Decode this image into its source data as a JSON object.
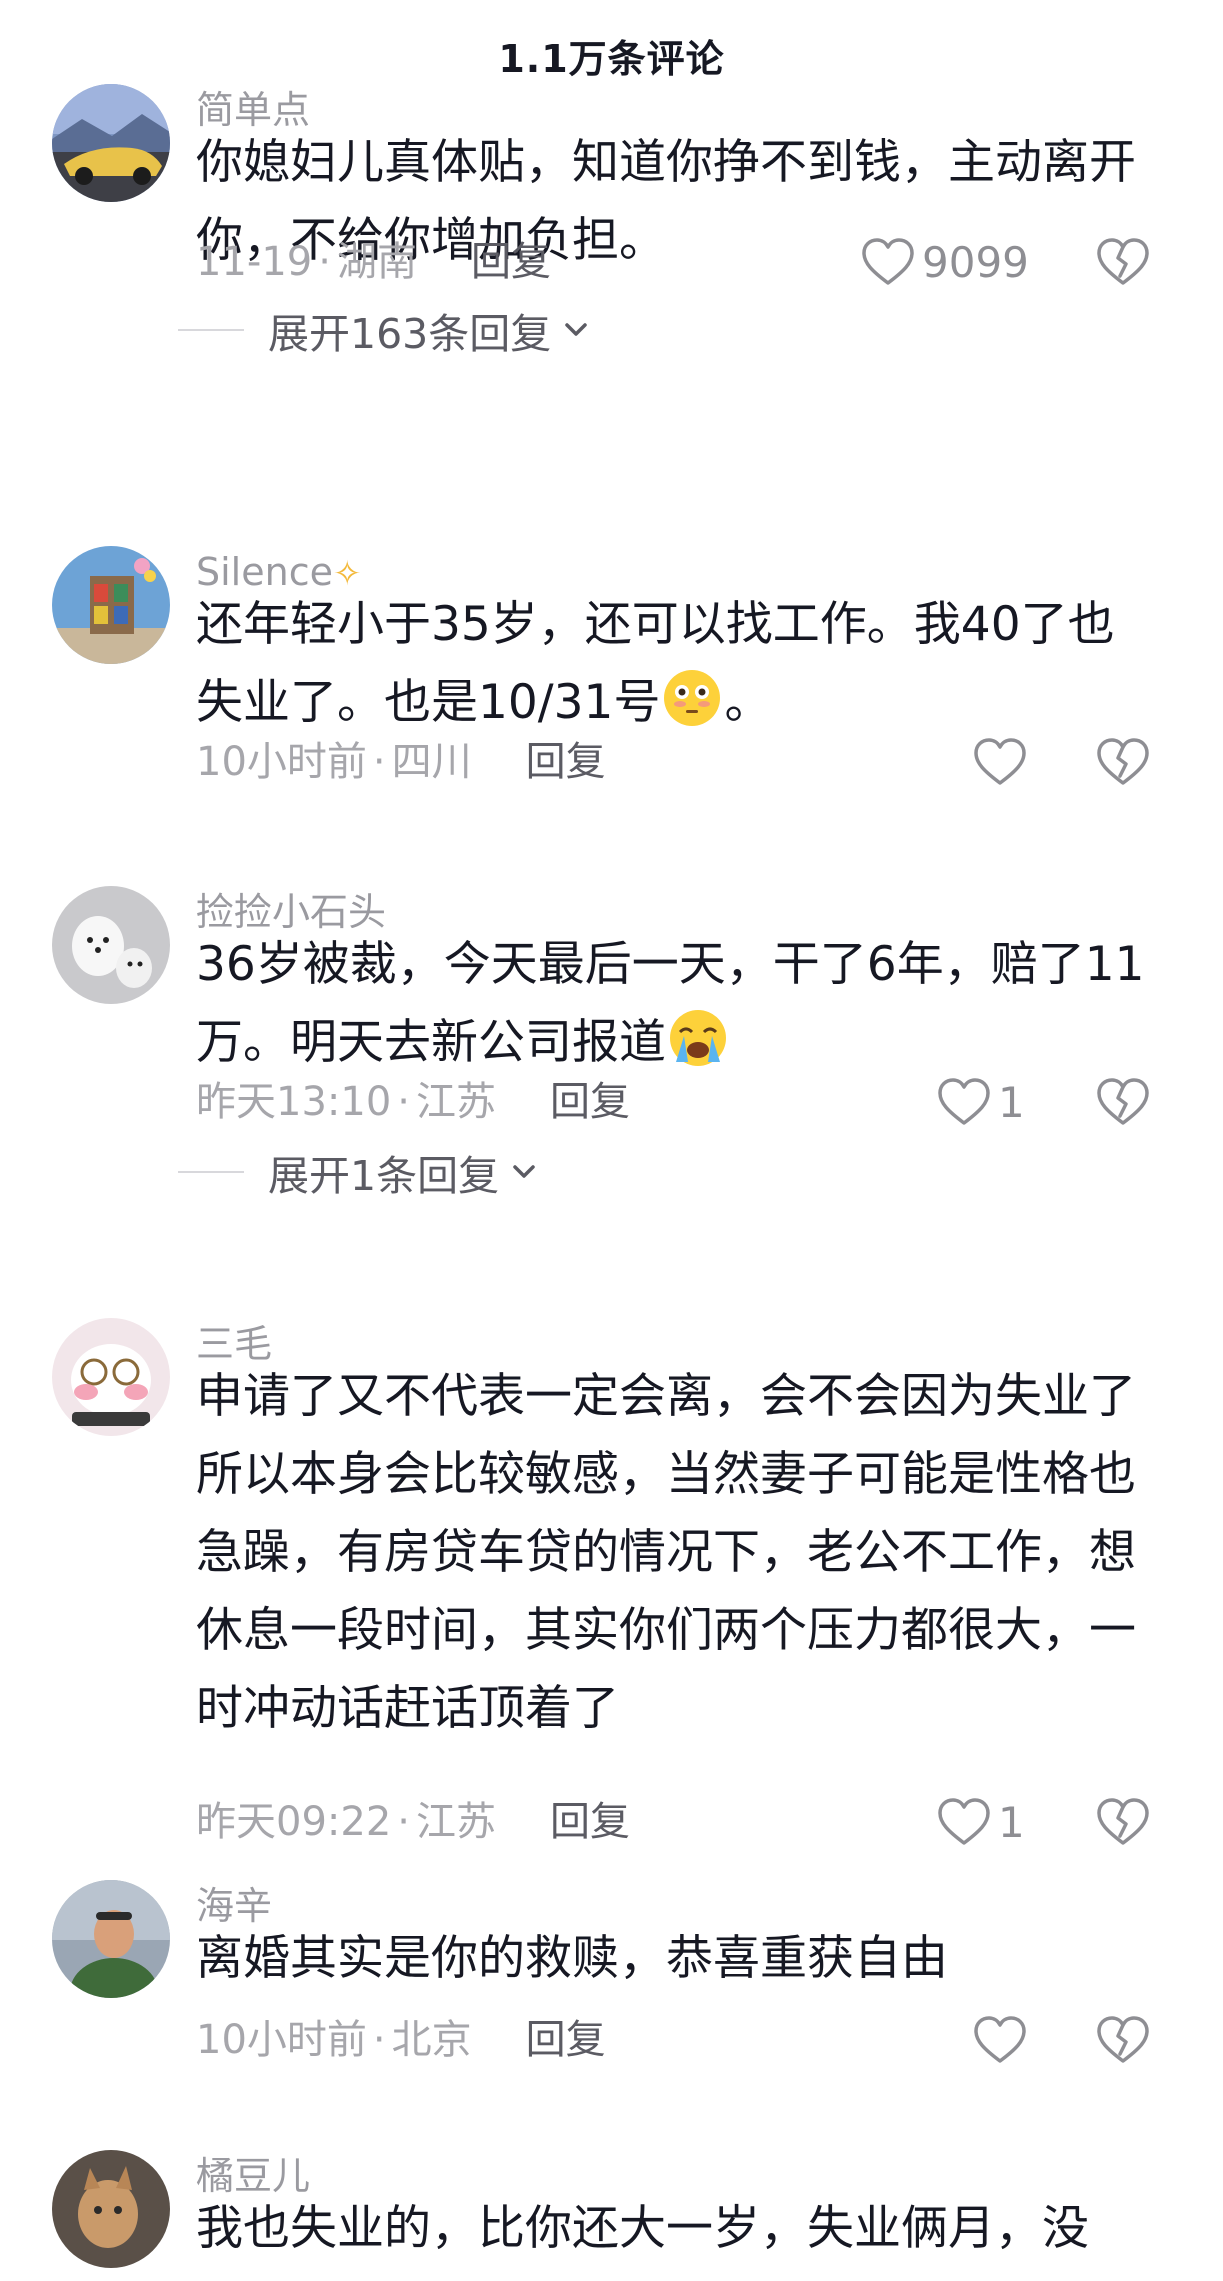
{
  "header": {
    "title": "1.1万条评论"
  },
  "comments": [
    {
      "username": "简单点",
      "text": "你媳妇儿真体贴，知道你挣不到钱，主动离开你，不给你增加负担。",
      "time": "11-19",
      "location": "湖南",
      "reply_label": "回复",
      "likes": "9099",
      "expand_label": "展开163条回复"
    },
    {
      "username": "Silence",
      "username_emoji": "dizzy-emoji",
      "text_before_emoji": "还年轻小于35岁，还可以找工作。我40了也失业了。也是10/31号",
      "text_after_emoji": "。",
      "inline_emoji": "flushed-face-emoji",
      "time": "10小时前",
      "location": "四川",
      "reply_label": "回复",
      "likes": ""
    },
    {
      "username": "捡捡小石头",
      "text_before_emoji": "36岁被裁，今天最后一天，干了6年，赔了11万。明天去新公司报道",
      "inline_emoji": "crying-face-emoji",
      "time": "昨天13:10",
      "location": "江苏",
      "reply_label": "回复",
      "likes": "1",
      "expand_label": "展开1条回复"
    },
    {
      "username": "三毛",
      "text": "申请了又不代表一定会离，会不会因为失业了所以本身会比较敏感，当然妻子可能是性格也急躁，有房贷车贷的情况下，老公不工作，想休息一段时间，其实你们两个压力都很大，一时冲动话赶话顶着了",
      "time": "昨天09:22",
      "location": "江苏",
      "reply_label": "回复",
      "likes": "1"
    },
    {
      "username": "海辛",
      "text": "离婚其实是你的救赎，恭喜重获自由",
      "time": "10小时前",
      "location": "北京",
      "reply_label": "回复",
      "likes": ""
    },
    {
      "username": "橘豆儿",
      "text": "我也失业的，比你还大一岁，失业俩月，没"
    }
  ],
  "icons": {
    "like": "heart-outline-icon",
    "dislike": "broken-heart-icon",
    "expand": "chevron-down-icon"
  },
  "colors": {
    "text": "#161823",
    "secondary": "#a6a6ab",
    "reply": "#5b5b63"
  }
}
